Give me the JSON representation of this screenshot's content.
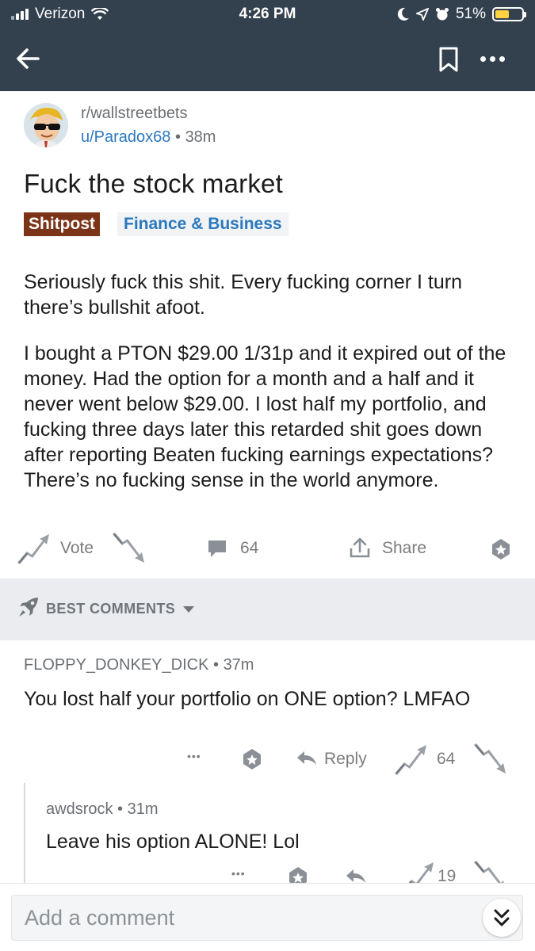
{
  "status_bar": {
    "carrier": "Verizon",
    "time": "4:26 PM",
    "battery": "51%",
    "battery_level": 0.51
  },
  "nav": {
    "back_icon": "back-arrow-icon",
    "bookmark_icon": "bookmark-icon",
    "more_icon": "more-dots-icon"
  },
  "post": {
    "subreddit": "r/wallstreetbets",
    "author": "u/Paradox68",
    "separator": "•",
    "age": "38m",
    "title": "Fuck the stock market",
    "flair_primary": "Shitpost",
    "flair_secondary": "Finance & Business",
    "body_p1": "Seriously fuck this shit. Every fucking corner I turn there’s bullshit afoot.",
    "body_p2": "I bought a PTON  $29.00 1/31p and it expired out of the money. Had the option for a month and a half and it never went below $29.00. I lost half my portfolio, and fucking three days later this retarded shit goes down after reporting Beaten fucking earnings expectations? There’s no fucking sense in the world anymore.",
    "vote_label": "Vote",
    "comment_count": "64",
    "share_label": "Share"
  },
  "sort": {
    "label": "BEST COMMENTS"
  },
  "comments": [
    {
      "author": "FLOPPY_DONKEY_DICK",
      "age": "37m",
      "text": "You lost half your portfolio on ONE option? LMFAO",
      "more": "•••",
      "reply_label": "Reply",
      "score": "64"
    },
    {
      "author": "awdsrock",
      "age": "31m",
      "text": "Leave his option ALONE! Lol",
      "more": "•••",
      "score": "19"
    }
  ],
  "composer": {
    "placeholder": "Add a comment"
  },
  "colors": {
    "header_bg": "#33414f",
    "link_blue": "#2b78bd",
    "flair_brown": "#7b3418",
    "battery_yellow": "#ffd23f"
  }
}
